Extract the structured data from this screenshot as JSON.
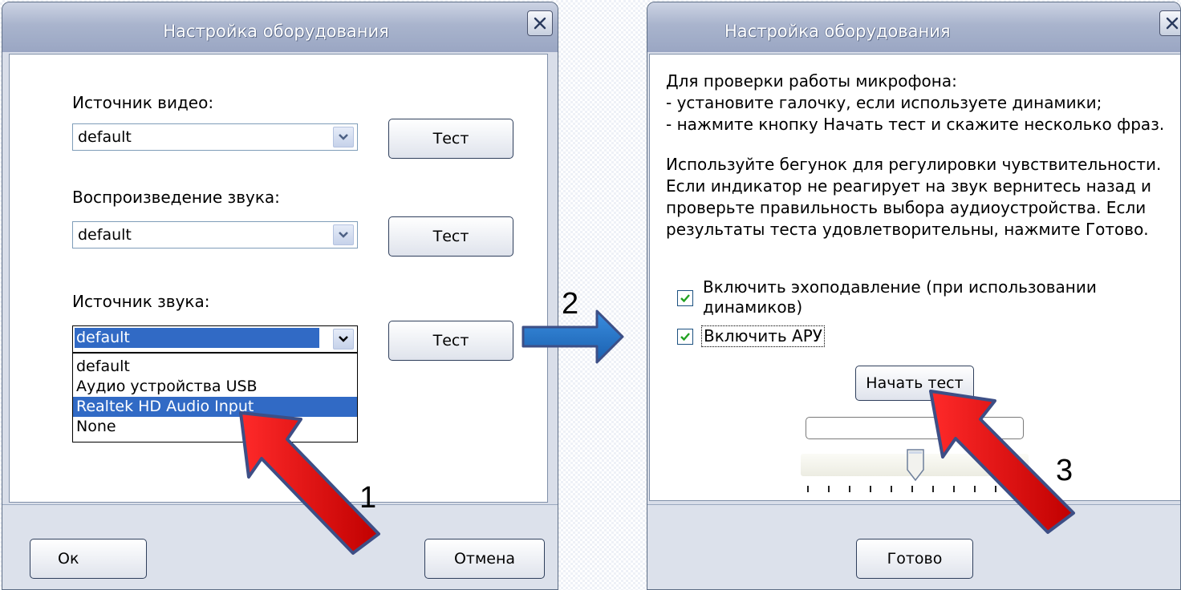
{
  "left_dialog": {
    "title": "Настройка оборудования",
    "video_source_label": "Источник видео:",
    "video_source_value": "default",
    "playback_label": "Воспроизведение звука:",
    "playback_value": "default",
    "audio_source_label": "Источник звука:",
    "audio_source_value": "default",
    "test_label": "Тест",
    "dropdown_options": [
      "default",
      "Аудио устройства USB",
      "Realtek HD Audio Input",
      "None"
    ],
    "ok_label": "Ок",
    "cancel_label": "Отмена"
  },
  "right_dialog": {
    "title": "Настройка оборудования",
    "instructions_1": [
      "Для проверки работы микрофона:",
      "- установите галочку, если используете динамики;",
      "- нажмите кнопку Начать тест и скажите несколько фраз."
    ],
    "instructions_2": [
      "Используйте бегунок для регулировки чувствительности.",
      "Если индикатор не реагирует на звук вернитесь назад и",
      "проверьте правильность выбора аудиоустройства. Если",
      "результаты теста удовлетворительны, нажмите Готово."
    ],
    "echo_cancel_label_line1": "Включить эхоподавление (при использовании",
    "echo_cancel_label_line2": "динамиков)",
    "echo_cancel_checked": true,
    "agc_label": "Включить АРУ",
    "agc_checked": true,
    "start_test_label": "Начать тест",
    "done_label": "Готово"
  },
  "annotations": {
    "step1": "1",
    "step2": "2",
    "step3": "3"
  },
  "colors": {
    "selection": "#316ac5",
    "arrow_red": "#e30613",
    "arrow_blue": "#1f6fc4"
  }
}
